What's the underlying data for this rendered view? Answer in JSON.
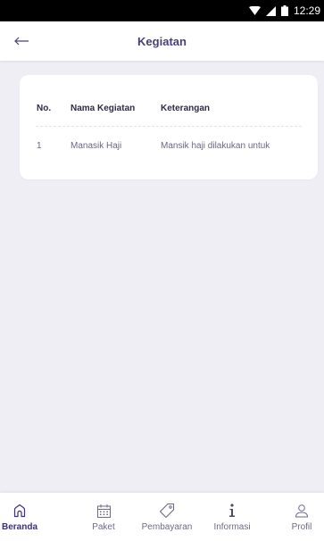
{
  "status_bar": {
    "time": "12:29",
    "icons": [
      "wifi-icon",
      "signal-icon",
      "battery-icon"
    ]
  },
  "app_bar": {
    "title": "Kegiatan",
    "back_icon": "back-arrow-icon"
  },
  "table": {
    "columns": [
      "No.",
      "Nama Kegiatan",
      "Keterangan"
    ],
    "rows": [
      [
        "1",
        "Manasik Haji",
        "Mansik haji dilakukan untuk"
      ]
    ]
  },
  "bottom_nav": {
    "active": "Beranda",
    "items": [
      {
        "label": "Beranda",
        "icon": "home-icon"
      },
      {
        "label": "Paket",
        "icon": "calendar-icon"
      },
      {
        "label": "Pembayaran",
        "icon": "tag-icon"
      },
      {
        "label": "Informasi",
        "icon": "info-icon"
      },
      {
        "label": "Profil",
        "icon": "user-icon"
      }
    ]
  },
  "colors": {
    "background": "#efeef4",
    "accent": "#3a2f80",
    "title": "#4a3f7a"
  }
}
